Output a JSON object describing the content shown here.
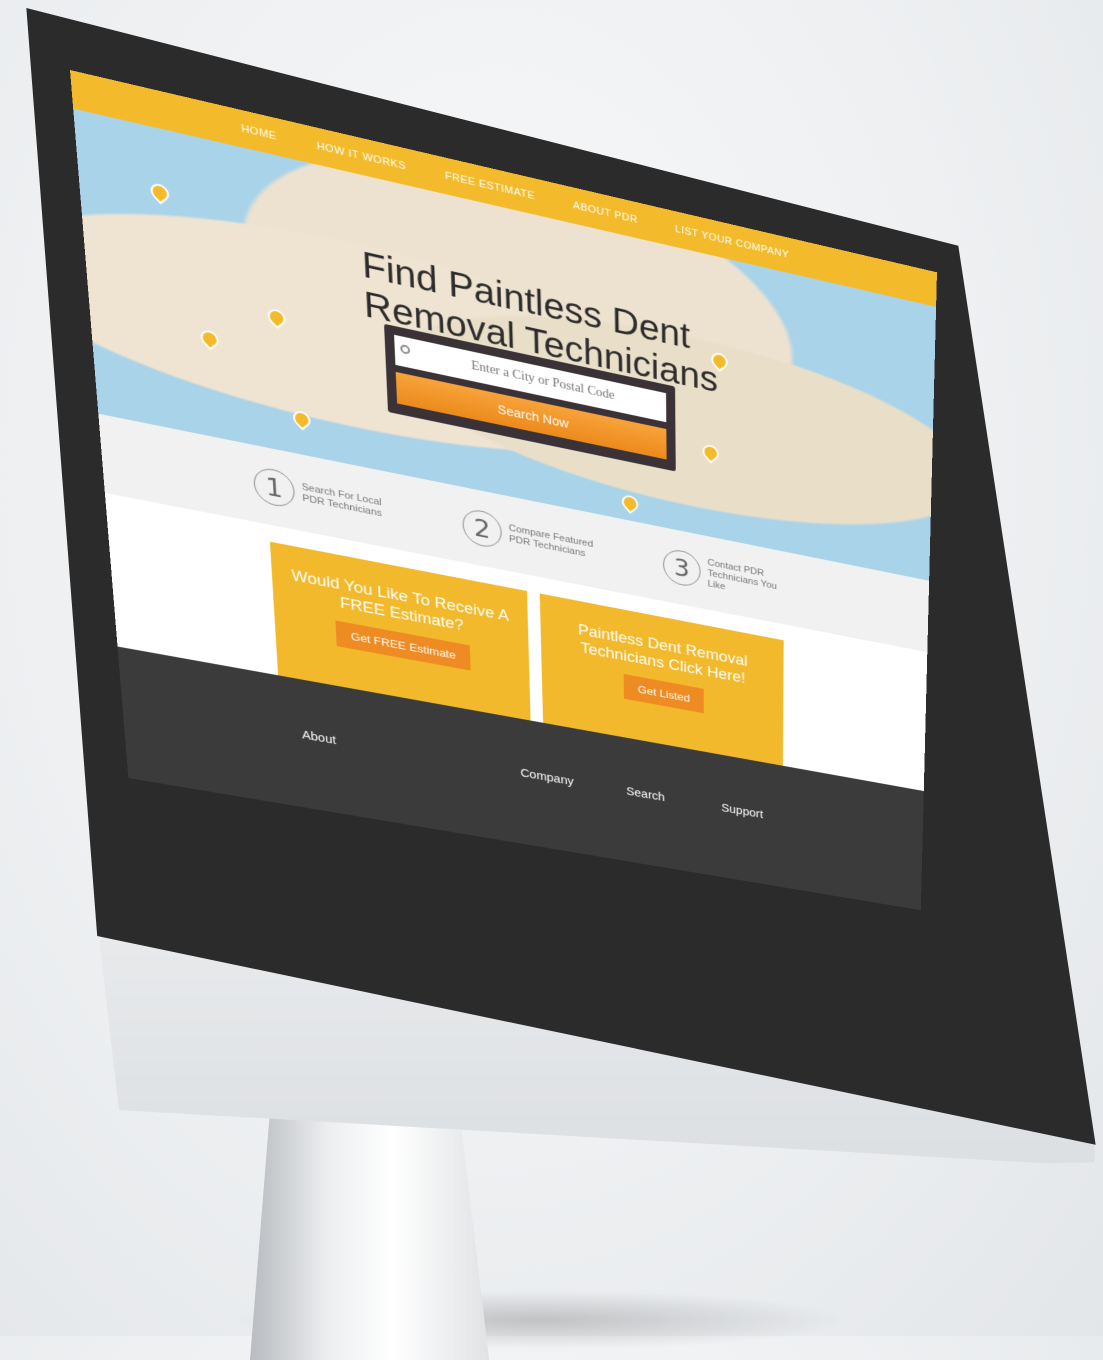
{
  "nav": {
    "items": [
      "HOME",
      "HOW IT WORKS",
      "FREE ESTIMATE",
      "ABOUT PDR",
      "LIST YOUR COMPANY"
    ]
  },
  "hero": {
    "title": "Find Paintless Dent Removal Technicians",
    "search_placeholder": "Enter a City or Postal Code",
    "search_button": "Search Now"
  },
  "steps": [
    {
      "num": "1",
      "text": "Search For Local PDR Technicians"
    },
    {
      "num": "2",
      "text": "Compare Featured PDR Technicians"
    },
    {
      "num": "3",
      "text": "Contact PDR Technicians You Like"
    }
  ],
  "cta": [
    {
      "title": "Would You Like To Receive A FREE Estimate?",
      "button": "Get FREE Estimate"
    },
    {
      "title": "Paintless Dent Removal Technicians Click Here!",
      "button": "Get Listed"
    }
  ],
  "footer": {
    "about": "About",
    "company": "Company",
    "search": "Search",
    "support": "Support"
  },
  "colors": {
    "accent": "#f3bb2b",
    "button_orange": "#ee8b22",
    "footer_bg": "#3b3b3b"
  }
}
